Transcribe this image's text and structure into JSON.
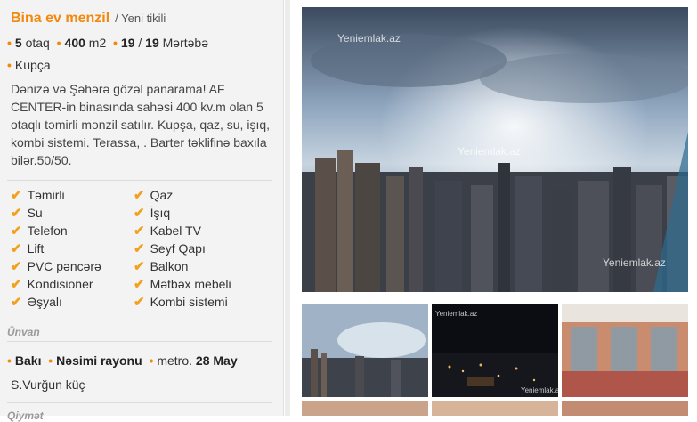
{
  "listing": {
    "title": "Bina ev menzil",
    "subtitle": "/ Yeni tikili",
    "rooms_value": "5",
    "rooms_unit": "otaq",
    "area_value": "400",
    "area_unit": "m2",
    "floor_value": "19",
    "floor_sep": "/",
    "floor_total": "19",
    "floor_unit": "Mərtəbə",
    "document": "Kupça",
    "description": "Dənizə və Şəhərə gözəl panarama! AF CENTER-in binasında sahəsi 400 kv.m olan 5 otaqlı təmirli mənzil satılır. Kupşa, qaz, su, işıq, kombi sistemi. Terassa, . Barter təklifinə baxıla bilər.50/50."
  },
  "features": {
    "left": [
      "Təmirli",
      "Su",
      "Telefon",
      "Lift",
      "PVC pəncərə",
      "Kondisioner",
      "Əşyalı"
    ],
    "right": [
      "Qaz",
      "İşıq",
      "Kabel TV",
      "Seyf Qapı",
      "Balkon",
      "Mətbəx mebeli",
      "Kombi sistemi"
    ]
  },
  "address": {
    "section_label": "Ünvan",
    "city": "Bakı",
    "district": "Nəsimi rayonu",
    "metro_label": "metro.",
    "metro": "28 May",
    "street": "S.Vurğun küç"
  },
  "next_section_label": "Qiymət",
  "gallery": {
    "watermark_main": "Yeniemlak.az",
    "watermark_thumb": "Yeniemlak.az"
  },
  "colors": {
    "accent": "#f2880c",
    "check": "#f2a11c"
  }
}
